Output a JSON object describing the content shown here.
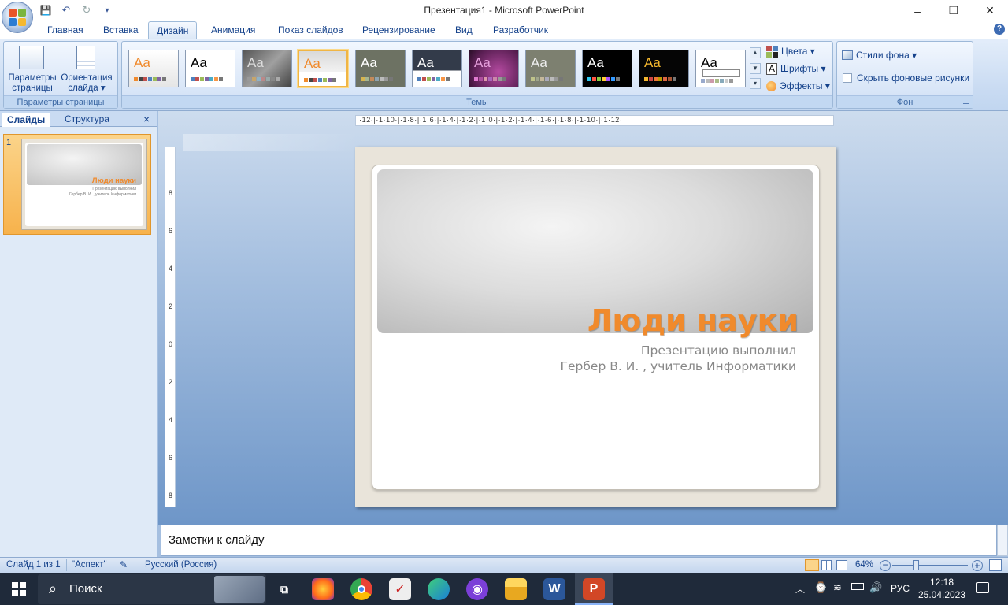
{
  "window": {
    "title": "Презентация1 - Microsoft PowerPoint",
    "minimize": "–",
    "maximize": "❐",
    "close": "✕"
  },
  "qat": {
    "save": "💾",
    "undo": "↶",
    "redo": "↻",
    "customize": "▾"
  },
  "tabs": [
    "Главная",
    "Вставка",
    "Дизайн",
    "Анимация",
    "Показ слайдов",
    "Рецензирование",
    "Вид",
    "Разработчик"
  ],
  "active_tab": "Дизайн",
  "help": "?",
  "ribbon": {
    "page_setup": {
      "btn1_line1": "Параметры",
      "btn1_line2": "страницы",
      "btn2_line1": "Ориентация",
      "btn2_line2": "слайда ▾",
      "label": "Параметры страницы"
    },
    "themes": {
      "label": "Темы",
      "aa": "Aa"
    },
    "theme_options": {
      "colors": "Цвета ▾",
      "fonts": "Шрифты ▾",
      "effects": "Эффекты ▾"
    },
    "background": {
      "styles": "Стили фона ▾",
      "hide": "Скрыть фоновые рисунки",
      "label": "Фон"
    }
  },
  "left_panel": {
    "tab_slides": "Слайды",
    "tab_outline": "Структура",
    "close": "×",
    "slide_number": "1"
  },
  "thumb": {
    "title": "Люди науки",
    "sub1": "Презентацию выполнил",
    "sub2": "Гербер В. И. , учитель Информатики"
  },
  "rulers": {
    "h": "·12·|·1·10·|·1·8·|·1·6·|·1·4·|·1·2·|·1·0·|·1·2·|·1·4·|·1·6·|·1·8·|·1·10·|·1·12·",
    "v": [
      "8",
      "6",
      "4",
      "2",
      "0",
      "2",
      "4",
      "6",
      "8"
    ]
  },
  "slide": {
    "title": "Люди науки",
    "subtitle_line1": "Презентацию выполнил",
    "subtitle_line2": "Гербер В. И. , учитель Информатики"
  },
  "notes": {
    "placeholder": "Заметки к слайду"
  },
  "status": {
    "slide_info": "Слайд 1 из 1",
    "theme": "\"Аспект\"",
    "language": "Русский (Россия)",
    "zoom": "64%"
  },
  "taskbar": {
    "search": "Поиск",
    "lang": "РУС",
    "time": "12:18",
    "date": "25.04.2023"
  }
}
